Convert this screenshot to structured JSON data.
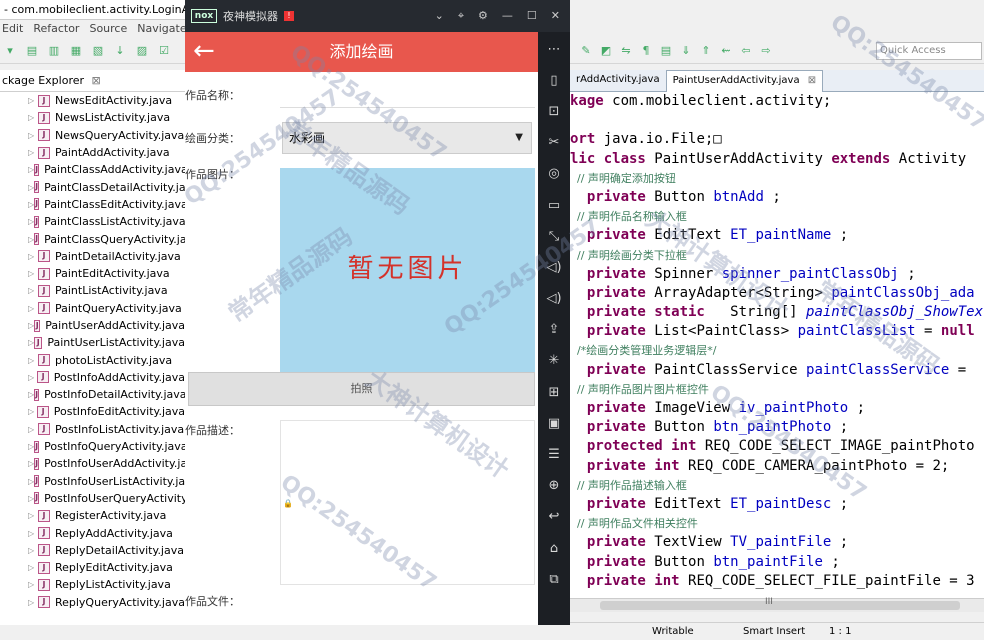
{
  "eclipse": {
    "window_title": "- com.mobileclient.activity.LoginActi",
    "menu": [
      "Edit",
      "Refactor",
      "Source",
      "Navigate"
    ],
    "package_explorer_title": "ckage Explorer",
    "package_explorer_close": "⊠",
    "files": [
      "NewsEditActivity.java",
      "NewsListActivity.java",
      "NewsQueryActivity.java",
      "PaintAddActivity.java",
      "PaintClassAddActivity.java",
      "PaintClassDetailActivity.java",
      "PaintClassEditActivity.java",
      "PaintClassListActivity.java",
      "PaintClassQueryActivity.java",
      "PaintDetailActivity.java",
      "PaintEditActivity.java",
      "PaintListActivity.java",
      "PaintQueryActivity.java",
      "PaintUserAddActivity.java",
      "PaintUserListActivity.java",
      "photoListActivity.java",
      "PostInfoAddActivity.java",
      "PostInfoDetailActivity.java",
      "PostInfoEditActivity.java",
      "PostInfoListActivity.java",
      "PostInfoQueryActivity.java",
      "PostInfoUserAddActivity.java",
      "PostInfoUserListActivity.java",
      "PostInfoUserQueryActivity.java",
      "RegisterActivity.java",
      "ReplyAddActivity.java",
      "ReplyDetailActivity.java",
      "ReplyEditActivity.java",
      "ReplyListActivity.java",
      "ReplyQueryActivity.java"
    ],
    "quick_access_placeholder": "Quick Access",
    "tabs": [
      {
        "label": "rAddActivity.java",
        "active": false
      },
      {
        "label": "PaintUserAddActivity.java",
        "active": true,
        "close": "⊠"
      }
    ],
    "status": {
      "writable": "Writable",
      "insert": "Smart Insert",
      "position": "1 : 1"
    },
    "scrollbar_grip": "III"
  },
  "code_lines": [
    [
      [
        "kw",
        "kage"
      ],
      [
        "",
        "com.mobileclient.activity;"
      ]
    ],
    [
      [
        "",
        ""
      ]
    ],
    [
      [
        "kw",
        "ort"
      ],
      [
        "",
        "java.io.File;□"
      ]
    ],
    [
      [
        "kw",
        "lic class"
      ],
      [
        "",
        "PaintUserAddActivity "
      ],
      [
        "kw",
        "extends"
      ],
      [
        "",
        "Activity"
      ]
    ],
    [
      [
        "",
        ""
      ],
      [
        "cm",
        "  // 声明确定添加按钮"
      ]
    ],
    [
      [
        "",
        ""
      ],
      [
        "kw",
        "  private"
      ],
      [
        "",
        "Button "
      ],
      [
        "fv",
        "btnAdd"
      ],
      [
        "",
        ";"
      ]
    ],
    [
      [
        "",
        ""
      ],
      [
        "cm",
        "  // 声明作品名称输入框"
      ]
    ],
    [
      [
        "",
        ""
      ],
      [
        "kw",
        "  private"
      ],
      [
        "",
        "EditText "
      ],
      [
        "fv",
        "ET_paintName"
      ],
      [
        "",
        ";"
      ]
    ],
    [
      [
        "",
        ""
      ],
      [
        "cm",
        "  // 声明绘画分类下拉框"
      ]
    ],
    [
      [
        "",
        ""
      ],
      [
        "kw",
        "  private"
      ],
      [
        "",
        "Spinner "
      ],
      [
        "fv",
        "spinner_paintClassObj"
      ],
      [
        "",
        ";"
      ]
    ],
    [
      [
        "",
        ""
      ],
      [
        "kw",
        "  private"
      ],
      [
        "",
        "ArrayAdapter<String> "
      ],
      [
        "fv",
        "paintClassObj_ada"
      ]
    ],
    [
      [
        "",
        ""
      ],
      [
        "kw",
        "  private static"
      ],
      [
        "",
        "  String[] "
      ],
      [
        "fi",
        "paintClassObj_ShowTex"
      ]
    ],
    [
      [
        "",
        ""
      ],
      [
        "kw",
        "  private"
      ],
      [
        "",
        "List<PaintClass> "
      ],
      [
        "fv",
        "paintClassList"
      ],
      [
        "",
        "= "
      ],
      [
        "kw",
        "null"
      ]
    ],
    [
      [
        "",
        ""
      ],
      [
        "cm",
        "  /*绘画分类管理业务逻辑层*/"
      ]
    ],
    [
      [
        "",
        ""
      ],
      [
        "kw",
        "  private"
      ],
      [
        "",
        "PaintClassService "
      ],
      [
        "fv",
        "paintClassService"
      ],
      [
        "",
        "="
      ]
    ],
    [
      [
        "",
        ""
      ],
      [
        "cm",
        "  // 声明作品图片图片框控件"
      ]
    ],
    [
      [
        "",
        ""
      ],
      [
        "kw",
        "  private"
      ],
      [
        "",
        "ImageView "
      ],
      [
        "fv",
        "iv_paintPhoto"
      ],
      [
        "",
        ";"
      ]
    ],
    [
      [
        "",
        ""
      ],
      [
        "kw",
        "  private"
      ],
      [
        "",
        "Button "
      ],
      [
        "fv",
        "btn_paintPhoto"
      ],
      [
        "",
        ";"
      ]
    ],
    [
      [
        "",
        ""
      ],
      [
        "kw",
        "  protected int"
      ],
      [
        "",
        "REQ_CODE_SELECT_IMAGE_paintPhoto"
      ]
    ],
    [
      [
        "",
        ""
      ],
      [
        "kw",
        "  private int"
      ],
      [
        "",
        "REQ_CODE_CAMERA_paintPhoto = 2;"
      ]
    ],
    [
      [
        "",
        ""
      ],
      [
        "cm",
        "  // 声明作品描述输入框"
      ]
    ],
    [
      [
        "",
        ""
      ],
      [
        "kw",
        "  private"
      ],
      [
        "",
        "EditText "
      ],
      [
        "fv",
        "ET_paintDesc"
      ],
      [
        "",
        ";"
      ]
    ],
    [
      [
        "",
        ""
      ],
      [
        "cm",
        "  // 声明作品文件相关控件"
      ]
    ],
    [
      [
        "",
        ""
      ],
      [
        "kw",
        "  private"
      ],
      [
        "",
        "TextView "
      ],
      [
        "fv",
        "TV_paintFile"
      ],
      [
        "",
        ";"
      ]
    ],
    [
      [
        "",
        ""
      ],
      [
        "kw",
        "  private"
      ],
      [
        "",
        "Button "
      ],
      [
        "fv",
        "btn_paintFile"
      ],
      [
        "",
        ";"
      ]
    ],
    [
      [
        "",
        ""
      ],
      [
        "kw",
        "  private int"
      ],
      [
        "",
        "REQ_CODE_SELECT_FILE_paintFile = 3"
      ]
    ]
  ],
  "nox": {
    "logo": "nox",
    "name": "夜神模拟器",
    "badge": "!",
    "controls": [
      "⌄",
      "⌖",
      "⚙",
      "—",
      "☐",
      "✕"
    ],
    "side_icons": [
      "⋯",
      "▯",
      "⊡",
      "✂",
      "◎",
      "▭",
      "⤡",
      "◁)",
      "◁)",
      "⇪",
      "✳",
      "⊞",
      "▣",
      "☰",
      "⊕",
      "↩",
      "⌂",
      "⧉"
    ]
  },
  "app": {
    "title": "添加绘画",
    "back_icon": "←",
    "label_name": "作品名称：",
    "label_class": "绘画分类：",
    "class_value": "水彩画",
    "label_photo": "作品图片：",
    "no_image": "暂无图片",
    "shoot_button": "拍照",
    "label_desc": "作品描述：",
    "label_file": "作品文件："
  },
  "watermarks": {
    "qq": "QQ:254540457",
    "a": "大神计算机设计",
    "b": "常年精品源码"
  }
}
